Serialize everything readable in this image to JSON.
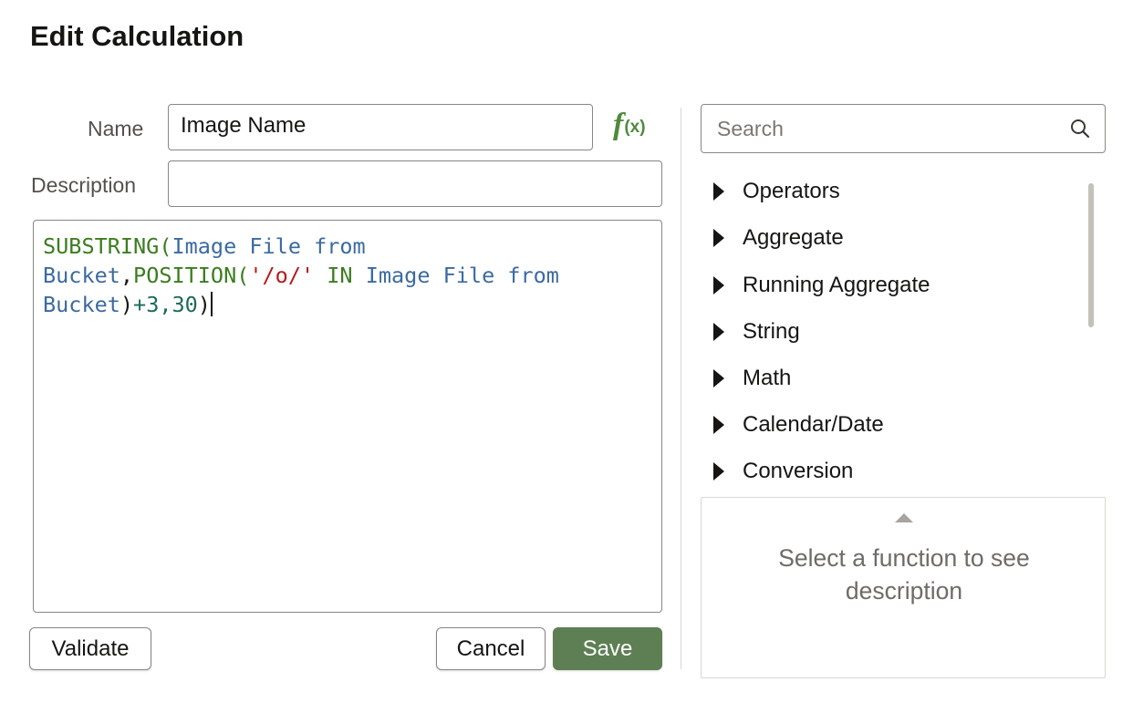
{
  "dialog": {
    "title": "Edit Calculation"
  },
  "form": {
    "name_label": "Name",
    "name_value": "Image Name",
    "description_label": "Description",
    "description_value": "",
    "fx_icon": "function-icon"
  },
  "expression": {
    "line1": [
      "SUBSTRING(",
      "Image File from"
    ],
    "line2": [
      "Bucket",
      ",",
      "POSITION(",
      "'/o/'",
      " IN ",
      "Image File from"
    ],
    "line3": [
      "Bucket",
      ")",
      "+3,30",
      ")"
    ]
  },
  "buttons": {
    "validate": "Validate",
    "cancel": "Cancel",
    "save": "Save"
  },
  "search": {
    "placeholder": "Search",
    "icon": "search-icon"
  },
  "categories": [
    {
      "label": "Operators"
    },
    {
      "label": "Aggregate"
    },
    {
      "label": "Running Aggregate"
    },
    {
      "label": "String"
    },
    {
      "label": "Math"
    },
    {
      "label": "Calendar/Date"
    },
    {
      "label": "Conversion"
    }
  ],
  "description_panel": {
    "message": "Select a function to see description"
  },
  "colors": {
    "accent": "#5d7f53",
    "keyword": "#3b7d1f",
    "column": "#3b6aa0",
    "string": "#b31b1b"
  }
}
